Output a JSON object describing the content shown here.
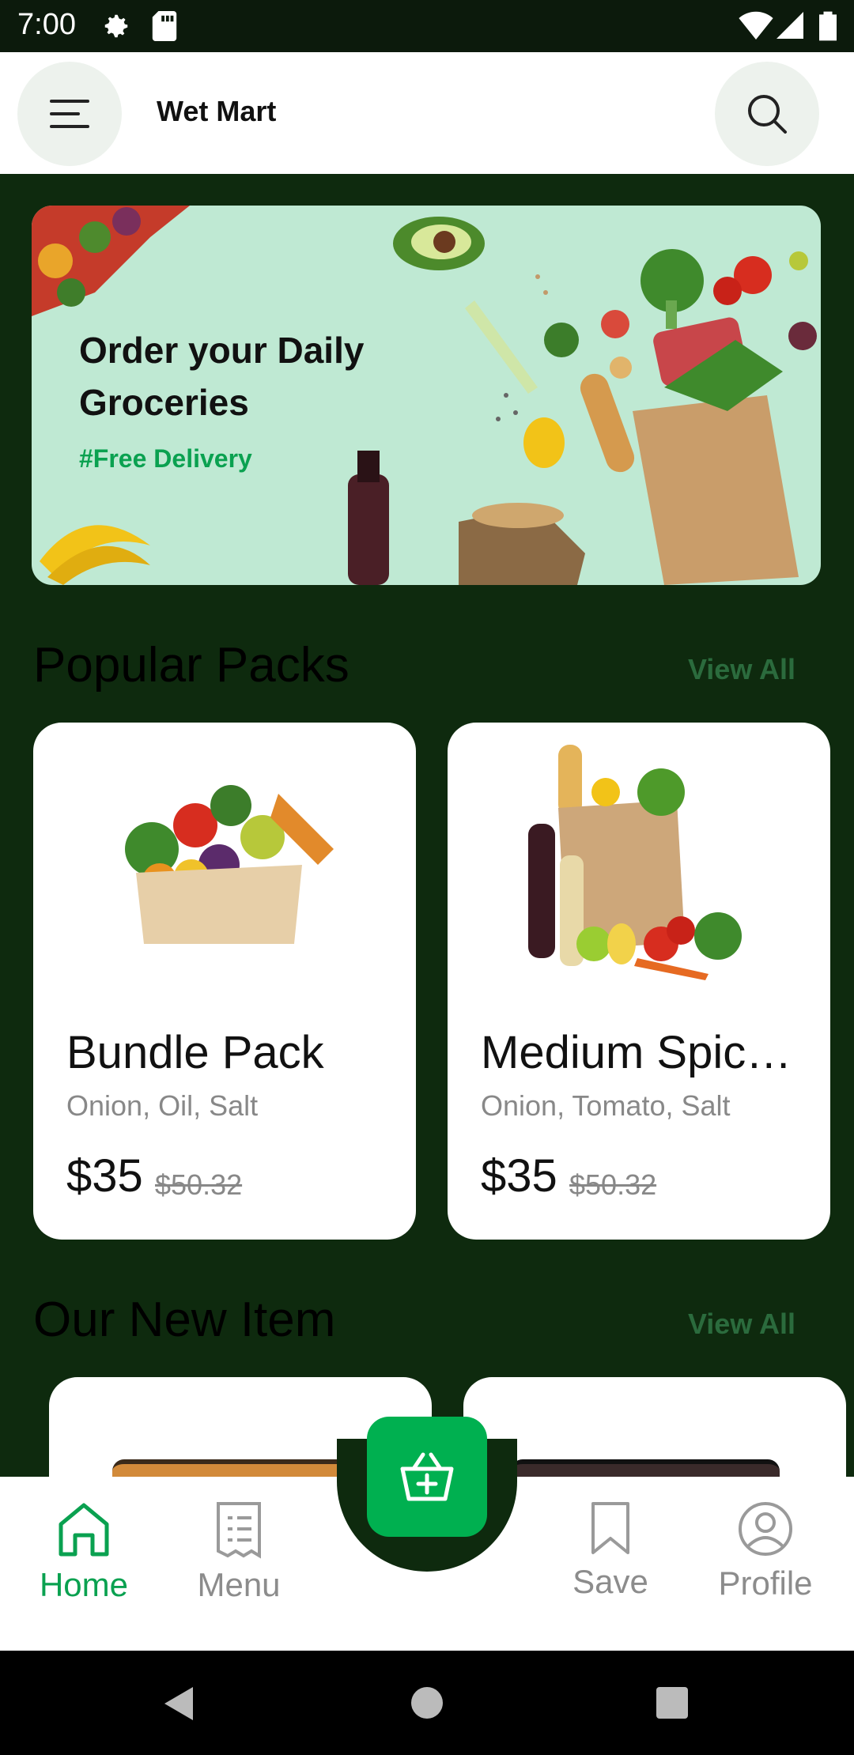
{
  "status_bar": {
    "time": "7:00"
  },
  "app_bar": {
    "title": "Wet Mart",
    "menu_icon": "hamburger-icon",
    "search_icon": "search-icon"
  },
  "banner": {
    "title": "Order your Daily Groceries",
    "subtitle": "#Free Delivery"
  },
  "popular": {
    "title": "Popular Packs",
    "view_all": "View All",
    "items": [
      {
        "name": "Bundle Pack",
        "desc": "Onion, Oil, Salt",
        "price": "$35",
        "old_price": "$50.32"
      },
      {
        "name": "Medium Spic…",
        "desc": "Onion, Tomato, Salt",
        "price": "$35",
        "old_price": "$50.32"
      }
    ]
  },
  "new_items": {
    "title": "Our New Item",
    "view_all": "View All"
  },
  "bottom_nav": {
    "items": [
      {
        "label": "Home",
        "icon": "home-icon",
        "active": true
      },
      {
        "label": "Menu",
        "icon": "receipt-icon",
        "active": false
      },
      {
        "label": "Save",
        "icon": "bookmark-icon",
        "active": false
      },
      {
        "label": "Profile",
        "icon": "profile-icon",
        "active": false
      }
    ],
    "fab_icon": "basket-add-icon"
  },
  "colors": {
    "accent": "#00b050",
    "dark_bg": "#0e2a0e",
    "banner_bg": "#bfe9d3"
  }
}
